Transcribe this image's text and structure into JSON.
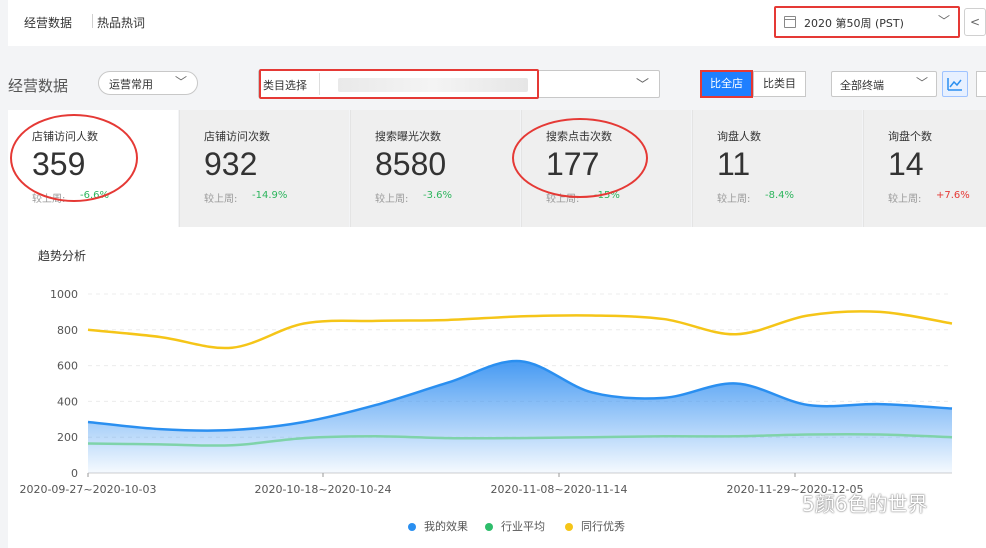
{
  "tabs": [
    {
      "label": "经营数据"
    },
    {
      "label": "热品热词"
    }
  ],
  "week_select": {
    "value": "2020 第50周 (PST)"
  },
  "section": {
    "title": "经营数据"
  },
  "scope_select": {
    "value": "运营常用"
  },
  "category_select": {
    "label": "类目选择"
  },
  "compare": {
    "all_label": "比全店",
    "category_label": "比类目"
  },
  "terminal_select": {
    "value": "全部终端"
  },
  "metrics": [
    {
      "label": "店铺访问人数",
      "value": "359",
      "compare_label": "较上周:",
      "change": "-6.6%",
      "direction": "down"
    },
    {
      "label": "店铺访问次数",
      "value": "932",
      "compare_label": "较上周:",
      "change": "-14.9%",
      "direction": "down"
    },
    {
      "label": "搜索曝光次数",
      "value": "8580",
      "compare_label": "较上周:",
      "change": "-3.6%",
      "direction": "down"
    },
    {
      "label": "搜索点击次数",
      "value": "177",
      "compare_label": "较上周:",
      "change": "-15%",
      "direction": "down"
    },
    {
      "label": "询盘人数",
      "value": "11",
      "compare_label": "较上周:",
      "change": "-8.4%",
      "direction": "down"
    },
    {
      "label": "询盘个数",
      "value": "14",
      "compare_label": "较上周:",
      "change": "+7.6%",
      "direction": "up"
    }
  ],
  "chart": {
    "title": "趋势分析"
  },
  "chart_data": {
    "type": "area",
    "x": [
      "2020-09-27~2020-10-03",
      "",
      "",
      "2020-10-18~2020-10-24",
      "",
      "",
      "2020-11-08~2020-11-14",
      "",
      "",
      "2020-11-29~2020-12-05",
      "",
      ""
    ],
    "tick_labels": [
      "2020-09-27~2020-10-03",
      "2020-10-18~2020-10-24",
      "2020-11-08~2020-11-14",
      "2020-11-29~2020-12-05"
    ],
    "yticks": [
      0,
      200,
      400,
      600,
      800,
      1000
    ],
    "ylim": [
      0,
      1000
    ],
    "grid": true,
    "legend_position": "bottom",
    "series": [
      {
        "name": "我的效果",
        "color": "#2a8ff0",
        "values": [
          285,
          245,
          240,
          285,
          380,
          505,
          625,
          450,
          420,
          500,
          380,
          385,
          360
        ]
      },
      {
        "name": "行业平均",
        "color": "#7fd3aa",
        "values": [
          165,
          160,
          155,
          195,
          205,
          195,
          195,
          200,
          205,
          205,
          215,
          215,
          200
        ]
      },
      {
        "name": "同行优秀",
        "color": "#f5c518",
        "values": [
          800,
          760,
          700,
          835,
          850,
          855,
          875,
          880,
          860,
          775,
          880,
          900,
          835
        ]
      }
    ]
  },
  "legend": [
    {
      "name": "我的效果",
      "color": "#2a8ff0"
    },
    {
      "name": "行业平均",
      "color": "#2ebd6b"
    },
    {
      "name": "同行优秀",
      "color": "#f5c518"
    }
  ],
  "watermark": {
    "text": "5颜6色的世界"
  }
}
